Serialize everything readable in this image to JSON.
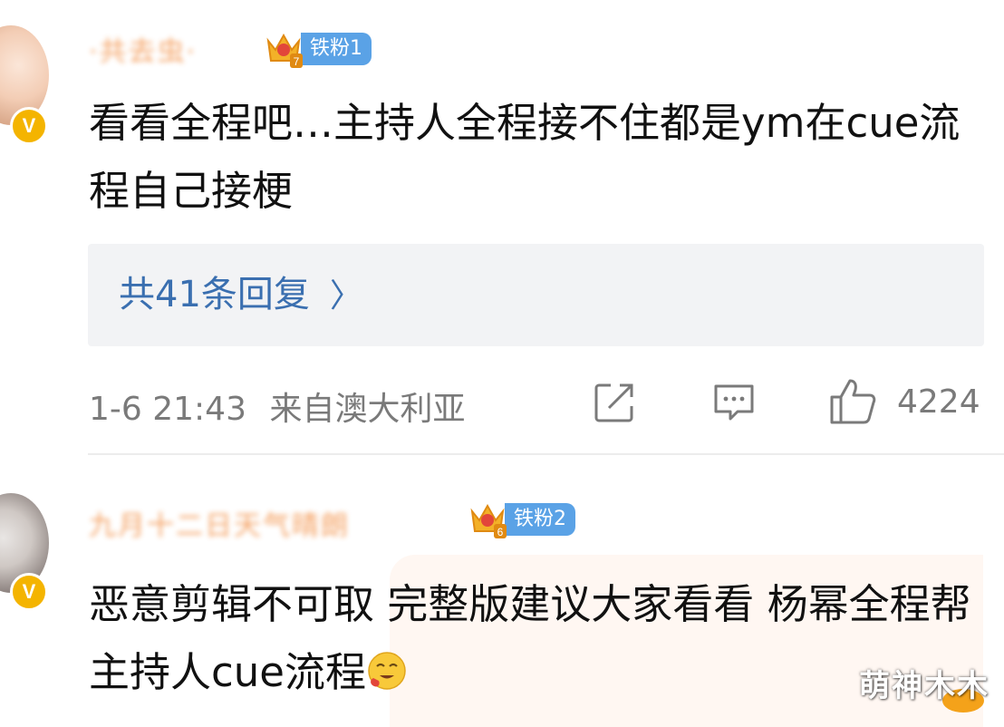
{
  "comments": [
    {
      "username": "·共去虫·",
      "badge": "铁粉1",
      "badge_level": "7",
      "content": "看看全程吧…主持人全程接不住都是ym在cue流程自己接梗",
      "replies_label": "共41条回复",
      "timestamp": "1-6 21:43",
      "location": "来自澳大利亚",
      "like_count": "4224"
    },
    {
      "username": "九月十二日天气晴朗",
      "badge": "铁粉2",
      "badge_level": "6",
      "content": "恶意剪辑不可取 完整版建议大家看看 杨幂全程帮主持人cue流程"
    }
  ],
  "icons": {
    "share": "share-icon",
    "comment": "comment-icon",
    "like": "thumbs-up-icon",
    "verified": "verified-v-icon",
    "badge_crown": "crown-icon",
    "reply_chevron": "chevron-right-icon",
    "emoji": "drooling-face-emoji"
  },
  "colors": {
    "username": "#f28a3c",
    "badge_bg": "#5aa2e6",
    "replies_text": "#3a6fb0",
    "replies_bg": "#f2f3f5",
    "meta_text": "#7a7a7a",
    "verified": "#f4b400"
  },
  "watermark": "萌神木木"
}
